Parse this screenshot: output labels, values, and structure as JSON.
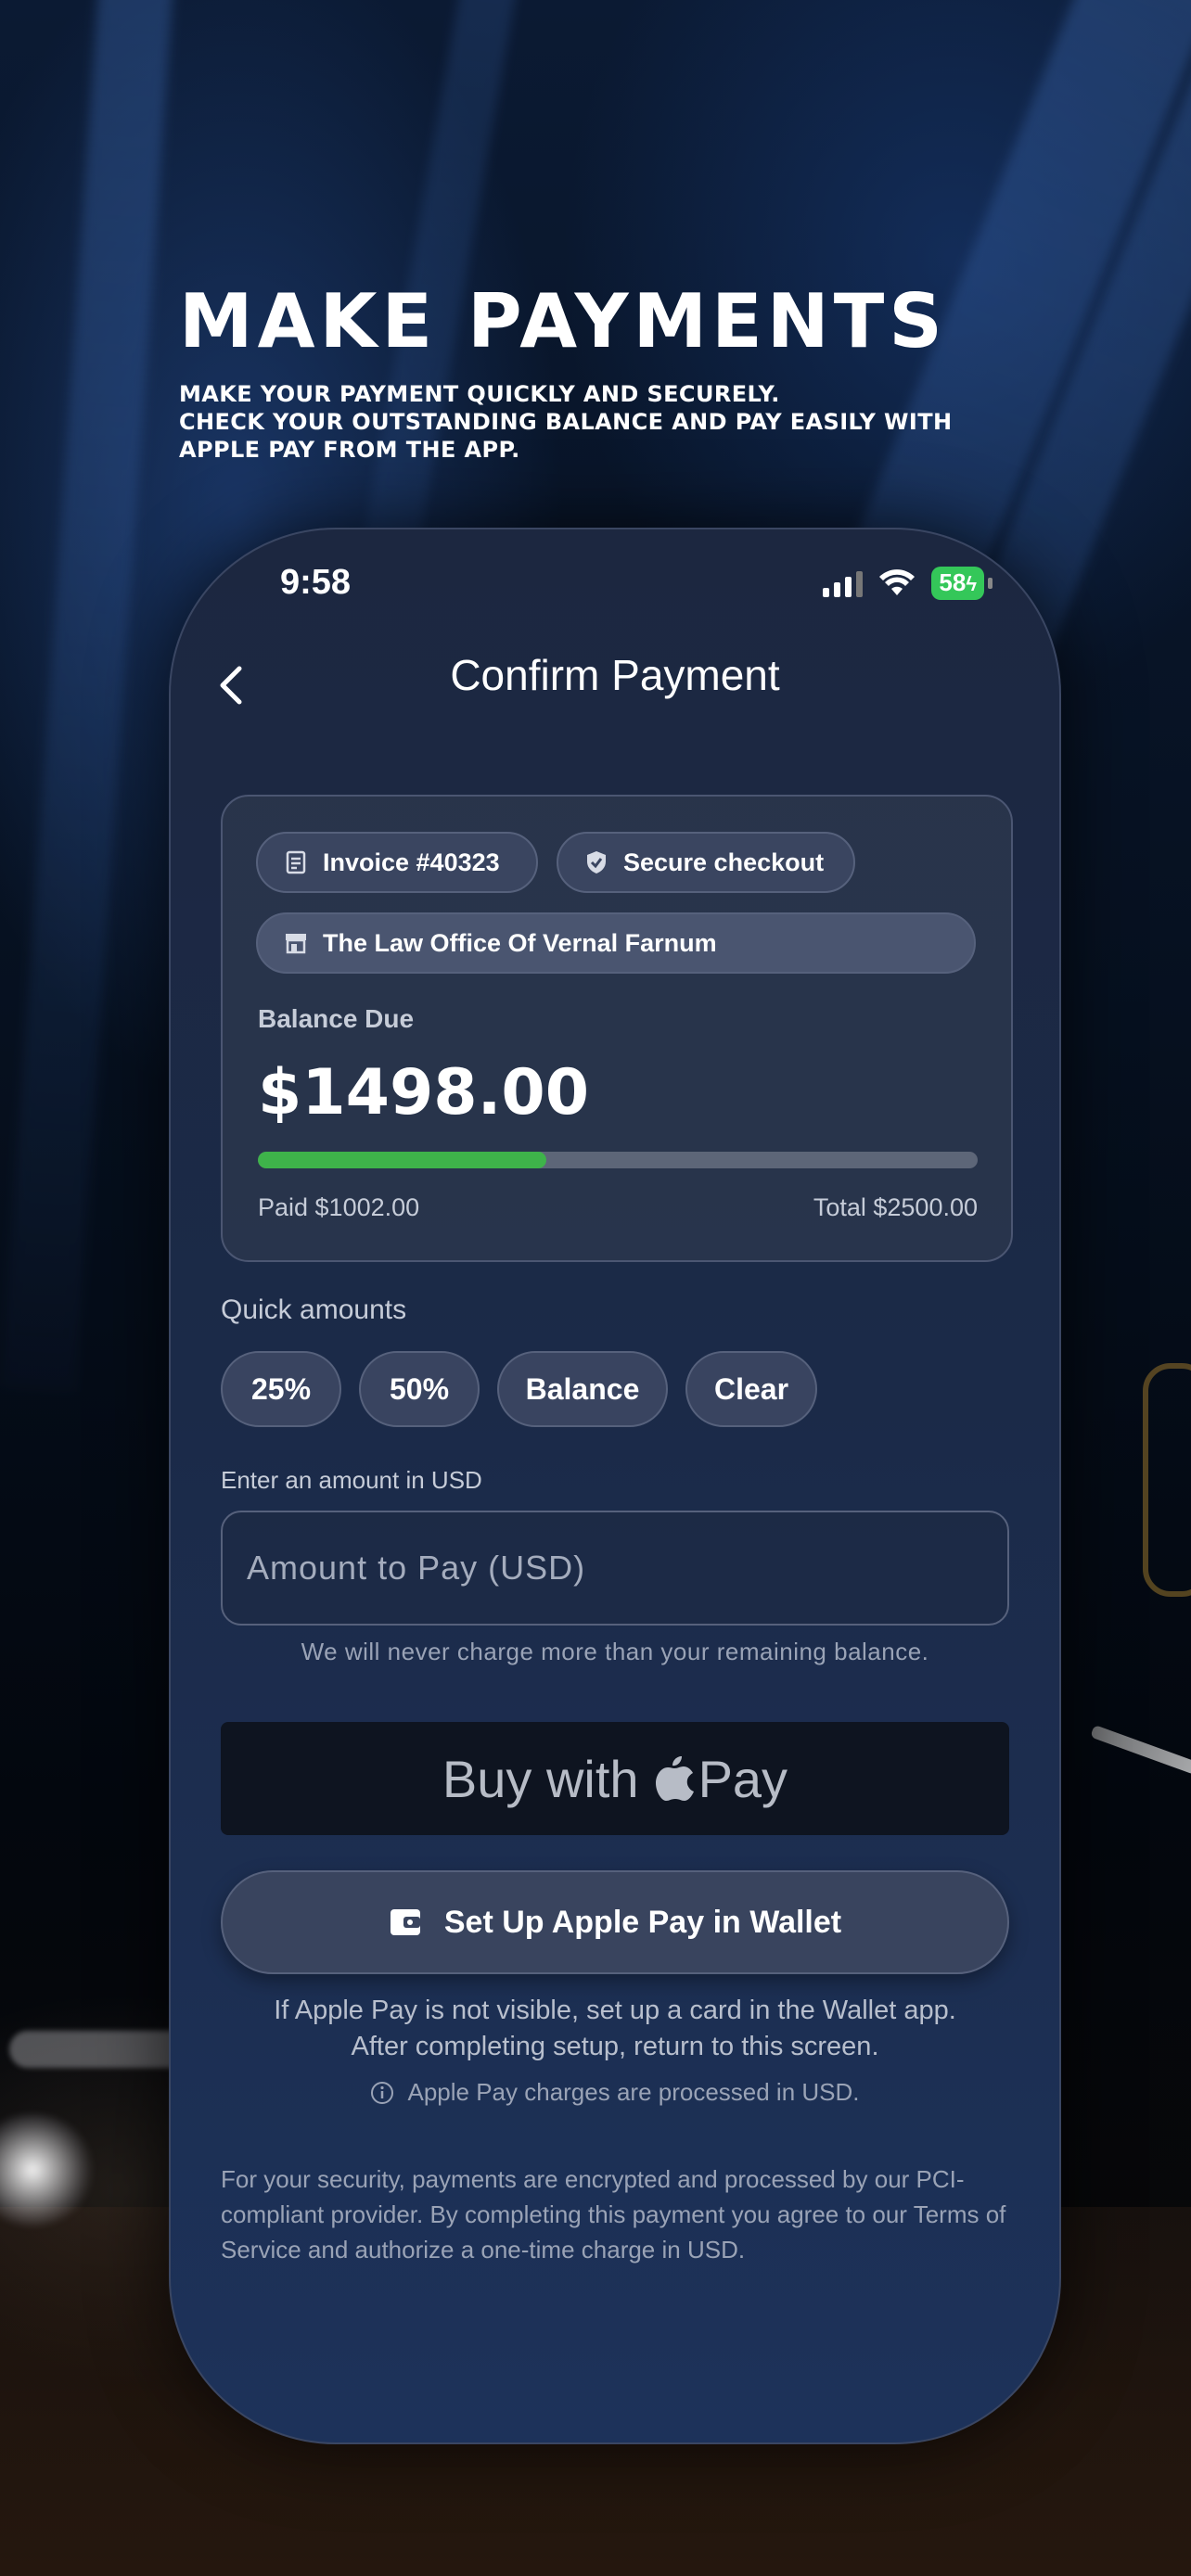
{
  "hero": {
    "title": "MAKE PAYMENTS",
    "subtitle_lines": [
      "MAKE YOUR PAYMENT QUICKLY AND SECURELY.",
      "CHECK YOUR OUTSTANDING BALANCE AND PAY EASILY WITH",
      "APPLE PAY FROM THE APP."
    ]
  },
  "status_bar": {
    "time": "9:58",
    "battery": "58"
  },
  "nav": {
    "title": "Confirm Payment"
  },
  "card": {
    "invoice_chip": "Invoice #40323",
    "secure_chip": "Secure checkout",
    "firm_chip": "The Law Office Of Vernal Farnum",
    "balance_label": "Balance Due",
    "balance_amount": "$1498.00",
    "paid_fraction": 0.4008,
    "paid_text": "Paid $1002.00",
    "total_text": "Total $2500.00"
  },
  "quick": {
    "label": "Quick amounts",
    "buttons": [
      "25%",
      "50%",
      "Balance",
      "Clear"
    ]
  },
  "amount": {
    "label": "Enter an amount in USD",
    "placeholder": "Amount to Pay (USD)",
    "value": "",
    "hint": "We will never charge more than your remaining balance."
  },
  "apple_pay": {
    "prefix": "Buy with",
    "suffix": "Pay"
  },
  "wallet_button": {
    "label": "Set Up Apple Pay in Wallet"
  },
  "info": {
    "line1": "If Apple Pay is not visible, set up a card in the Wallet app.",
    "line2": "After completing setup, return to this screen.",
    "notice": "Apple Pay charges are processed in USD."
  },
  "footer": "For your security, payments are encrypted and processed by our PCI-compliant provider. By completing this payment you agree to our Terms of Service and authorize a one-time charge in USD.",
  "colors": {
    "progress_fill": "#3eb34a",
    "battery": "#34c759",
    "card_bg": "#2e384e",
    "apple_pay_bg": "#0e1420"
  }
}
